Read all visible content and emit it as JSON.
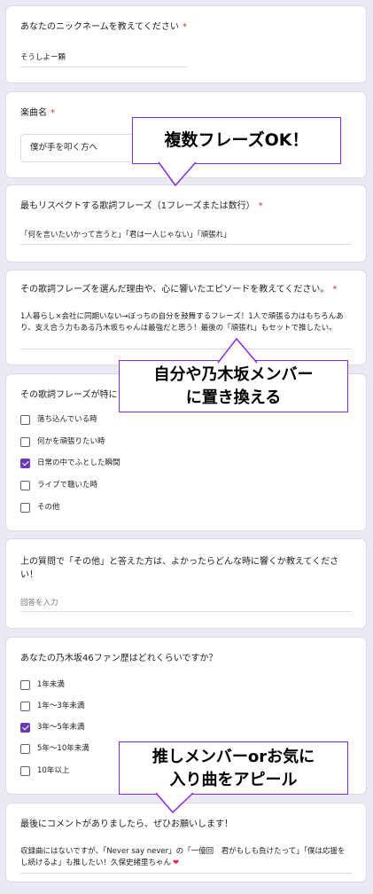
{
  "q1": {
    "title": "あなたのニックネームを教えてください",
    "required": "*",
    "answer": "そうしよー顆"
  },
  "q2": {
    "title": "楽曲名",
    "required": "*",
    "selected": "僕が手を叩く方へ"
  },
  "q3": {
    "title": "最もリスペクトする歌詞フレーズ（1フレーズまたは数行）",
    "required": "*",
    "answer": "「何を言いたいかって言うと」「君は一人じゃない」「頑張れ」"
  },
  "q4": {
    "title": "その歌詞フレーズを選んだ理由や、心に響いたエピソードを教えてください。",
    "required": "*",
    "answer": "1人暮らし×会社に同期いない→ぼっちの自分を鼓舞するフレーズ！1人で頑張る力はもちろんあり、支え合う力もある乃木坂ちゃんは最強だと思う！最後の「頑張れ」もセットで推したい。"
  },
  "q5": {
    "title": "その歌詞フレーズが特に",
    "options": [
      {
        "label": "落ち込んでいる時",
        "checked": false
      },
      {
        "label": "何かを頑張りたい時",
        "checked": false
      },
      {
        "label": "日常の中でふとした瞬間",
        "checked": true
      },
      {
        "label": "ライブで聴いた時",
        "checked": false
      },
      {
        "label": "その他",
        "checked": false
      }
    ]
  },
  "q6": {
    "title": "上の質問で「その他」と答えた方は、よかったらどんな時に響くか教えてください！",
    "placeholder": "回答を入力"
  },
  "q7": {
    "title": "あなたの乃木坂46ファン歴はどれくらいですか？",
    "options": [
      {
        "label": "1年未満",
        "checked": false
      },
      {
        "label": "1年〜3年未満",
        "checked": false
      },
      {
        "label": "3年〜5年未満",
        "checked": true
      },
      {
        "label": "5年〜10年未満",
        "checked": false
      },
      {
        "label": "10年以上",
        "checked": false
      }
    ]
  },
  "q8": {
    "title": "最後にコメントがありましたら、ぜひお願いします！",
    "answer": "収録曲にはないですが、「Never say never」の「一億回　君がもしも負けたって」「僕は応援をし続けるよ」も推したい！久保史緒里ちゃん",
    "heart": "❤"
  },
  "callouts": {
    "c1": "複数フレーズOK！",
    "c2_line1": "自分や乃木坂メンバー",
    "c2_line2": "に置き換える",
    "c3_line1": "推しメンバーorお気に",
    "c3_line2": "入り曲をアピール"
  },
  "colors": {
    "accent": "#673ab7",
    "callout_border": "#8a2be2",
    "required": "#d93025",
    "heart": "#e91e63"
  }
}
